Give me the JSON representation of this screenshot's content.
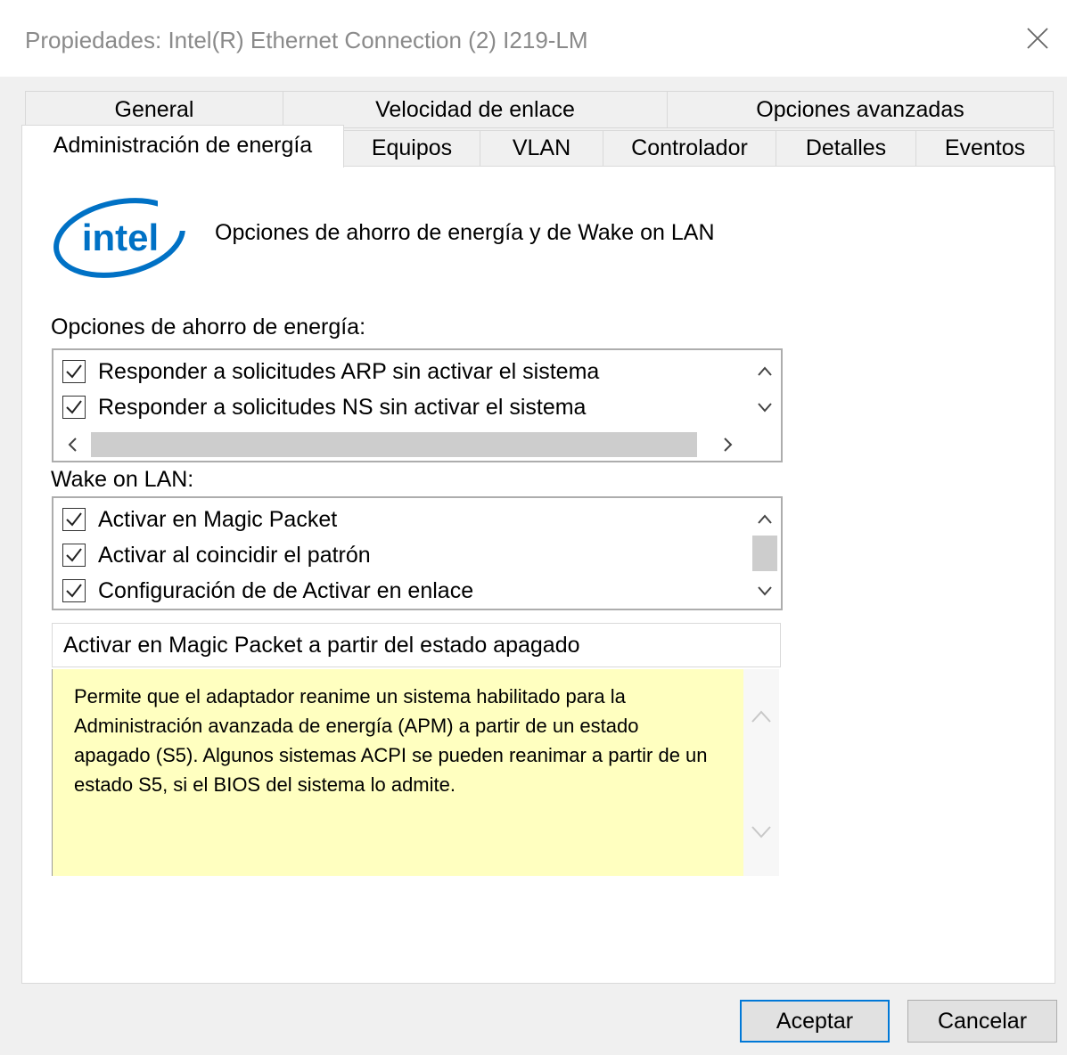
{
  "window": {
    "title": "Propiedades: Intel(R) Ethernet Connection (2) I219-LM"
  },
  "tabs": {
    "row1": [
      "General",
      "Velocidad de enlace",
      "Opciones avanzadas"
    ],
    "row2": [
      "Administración de energía",
      "Equipos",
      "VLAN",
      "Controlador",
      "Detalles",
      "Eventos"
    ],
    "active": "Administración de energía"
  },
  "panel": {
    "logo_text": "intel",
    "heading": "Opciones de ahorro de energía y de Wake on LAN",
    "power_saving": {
      "label": "Opciones de ahorro de energía:",
      "items": [
        {
          "label": "Responder a solicitudes ARP sin activar el sistema",
          "checked": true
        },
        {
          "label": "Responder a solicitudes NS sin activar el sistema",
          "checked": true
        }
      ]
    },
    "wol": {
      "label": "Wake on LAN:",
      "items": [
        {
          "label": "Activar en Magic Packet",
          "checked": true
        },
        {
          "label": "Activar al coincidir el patrón",
          "checked": true
        },
        {
          "label": "Configuración de de Activar en enlace",
          "checked": true
        }
      ]
    },
    "description": {
      "title": "Activar en Magic Packet a partir del estado apagado",
      "text": "Permite que el adaptador reanime un sistema habilitado para la Administración avanzada de energía (APM) a partir de un estado apagado (S5). Algunos sistemas ACPI se pueden reanimar a partir de un estado S5, si el BIOS del sistema lo admite."
    }
  },
  "buttons": {
    "ok": "Aceptar",
    "cancel": "Cancelar"
  },
  "colors": {
    "accent": "#0078d7",
    "help_background": "#ffffc0",
    "intel_blue": "#0071c5"
  }
}
